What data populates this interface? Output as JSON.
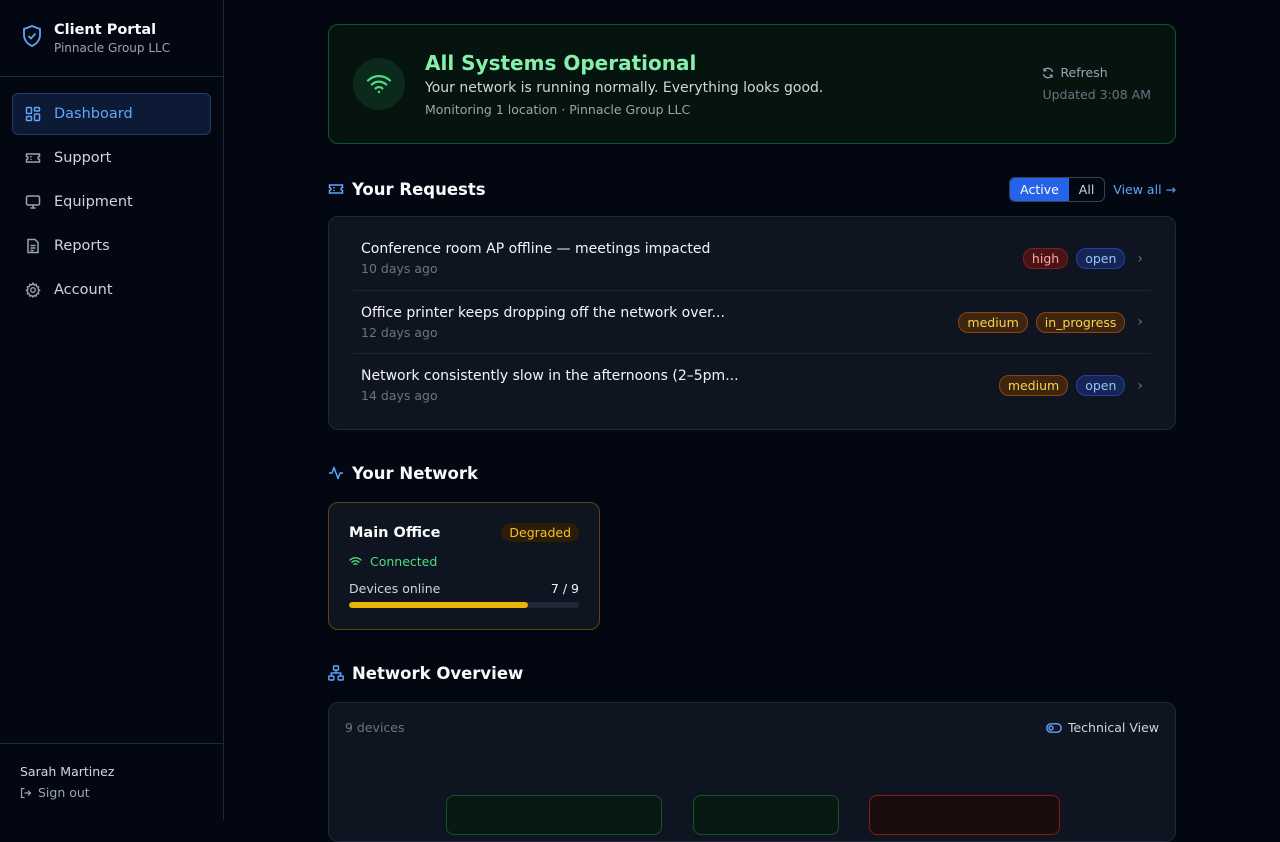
{
  "brand": {
    "title": "Client Portal",
    "subtitle": "Pinnacle Group LLC"
  },
  "nav": [
    {
      "label": "Dashboard",
      "icon": "dashboard-icon",
      "active": true
    },
    {
      "label": "Support",
      "icon": "ticket-icon"
    },
    {
      "label": "Equipment",
      "icon": "monitor-icon"
    },
    {
      "label": "Reports",
      "icon": "document-icon"
    },
    {
      "label": "Account",
      "icon": "gear-icon"
    }
  ],
  "user": {
    "name": "Sarah Martinez",
    "signout": "Sign out"
  },
  "status": {
    "title": "All Systems Operational",
    "subtitle": "Your network is running normally. Everything looks good.",
    "monitoring": "Monitoring 1 location · Pinnacle Group LLC",
    "refresh": "Refresh",
    "updated": "Updated 3:08 AM"
  },
  "requests": {
    "title": "Your Requests",
    "filter_active": "Active",
    "filter_all": "All",
    "view_all": "View all →",
    "items": [
      {
        "title": "Conference room AP offline — meetings impacted",
        "time": "10 days ago",
        "priority": "high",
        "status": "open"
      },
      {
        "title": "Office printer keeps dropping off the network over...",
        "time": "12 days ago",
        "priority": "medium",
        "status": "in_progress"
      },
      {
        "title": "Network consistently slow in the afternoons (2–5pm...",
        "time": "14 days ago",
        "priority": "medium",
        "status": "open"
      }
    ]
  },
  "network": {
    "title": "Your Network",
    "site": {
      "name": "Main Office",
      "health": "Degraded",
      "connection": "Connected",
      "devices_label": "Devices online",
      "devices_count": "7 / 9",
      "online_fraction": 0.78
    }
  },
  "overview": {
    "title": "Network Overview",
    "count": "9 devices",
    "toggle": "Technical View"
  },
  "colors": {
    "accent": "#2563eb",
    "success": "#86efac",
    "warning": "#eab308",
    "danger": "#fca5a5"
  }
}
